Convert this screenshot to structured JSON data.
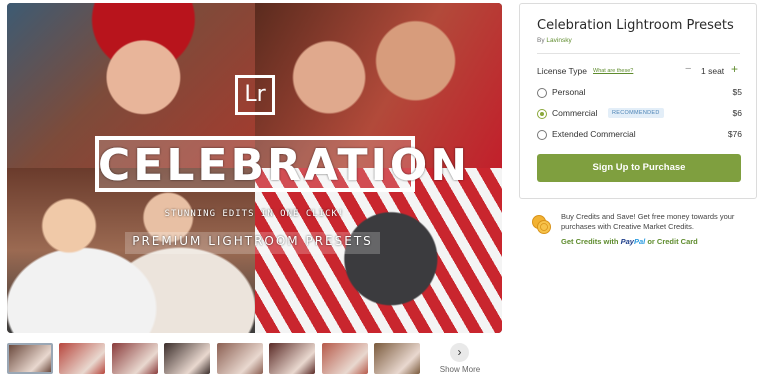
{
  "hero": {
    "logo": "Lr",
    "title": "CELEBRATION",
    "subtitle": "STUNNING EDITS IN ONE CLICK!",
    "premium": "PREMIUM LIGHTROOM PRESETS"
  },
  "gallery": {
    "thumb_colors": [
      "#6b4a3e",
      "#b7463d",
      "#8a3b3b",
      "#3a2d2a",
      "#8b5f52",
      "#5a2a26",
      "#b65a4a",
      "#7a5a3c"
    ],
    "next_icon": "chevron-right-icon",
    "show_more": "Show More"
  },
  "product": {
    "title": "Celebration Lightroom Presets",
    "by_prefix": "By",
    "author": "Lavinsky"
  },
  "license": {
    "label": "License Type",
    "what_link": "What are these?",
    "seat_count": "1 seat",
    "minus": "−",
    "plus": "+",
    "options": [
      {
        "name": "Personal",
        "price": "$5",
        "selected": false
      },
      {
        "name": "Commercial",
        "price": "$6",
        "selected": true,
        "badge": "RECOMMENDED"
      },
      {
        "name": "Extended Commercial",
        "price": "$76",
        "selected": false
      }
    ]
  },
  "purchase_button": "Sign Up to Purchase",
  "credits": {
    "text": "Buy Credits and Save! Get free money towards your purchases with Creative Market Credits.",
    "link_prefix": "Get Credits with",
    "paypal_a": "Pay",
    "paypal_b": "Pal",
    "link_suffix": "or Credit Card"
  },
  "colors": {
    "accent_green": "#7f9f3f",
    "link_green": "#5f8c2e",
    "badge_blue": "#e3eef8"
  }
}
